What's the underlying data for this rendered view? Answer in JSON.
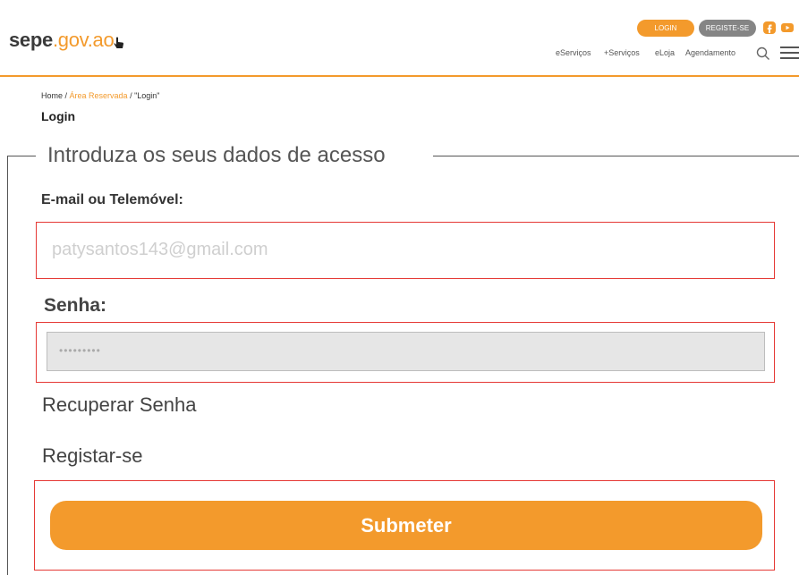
{
  "header": {
    "logo_main": "sepe",
    "logo_domain": ".gov.ao",
    "login_label": "LOGIN",
    "register_label": "REGISTE-SE",
    "nav": [
      "eServiços",
      "+Serviços",
      "eLoja",
      "Agendamento"
    ],
    "accent_color": "#f39a2c"
  },
  "breadcrumb": {
    "home": "Home",
    "sep1": " / ",
    "area": "Área Reservada",
    "sep2": " / ",
    "current": "\"Login\""
  },
  "page": {
    "title": "Login",
    "legend": "Introduza os seus dados de acesso"
  },
  "form": {
    "email_label": "E-mail ou Telemóvel:",
    "email_placeholder": "patysantos143@gmail.com",
    "password_label": "Senha:",
    "password_value": "•••••••••",
    "recover_link": "Recuperar Senha",
    "register_link": "Registar-se",
    "submit_label": "Submeter"
  }
}
